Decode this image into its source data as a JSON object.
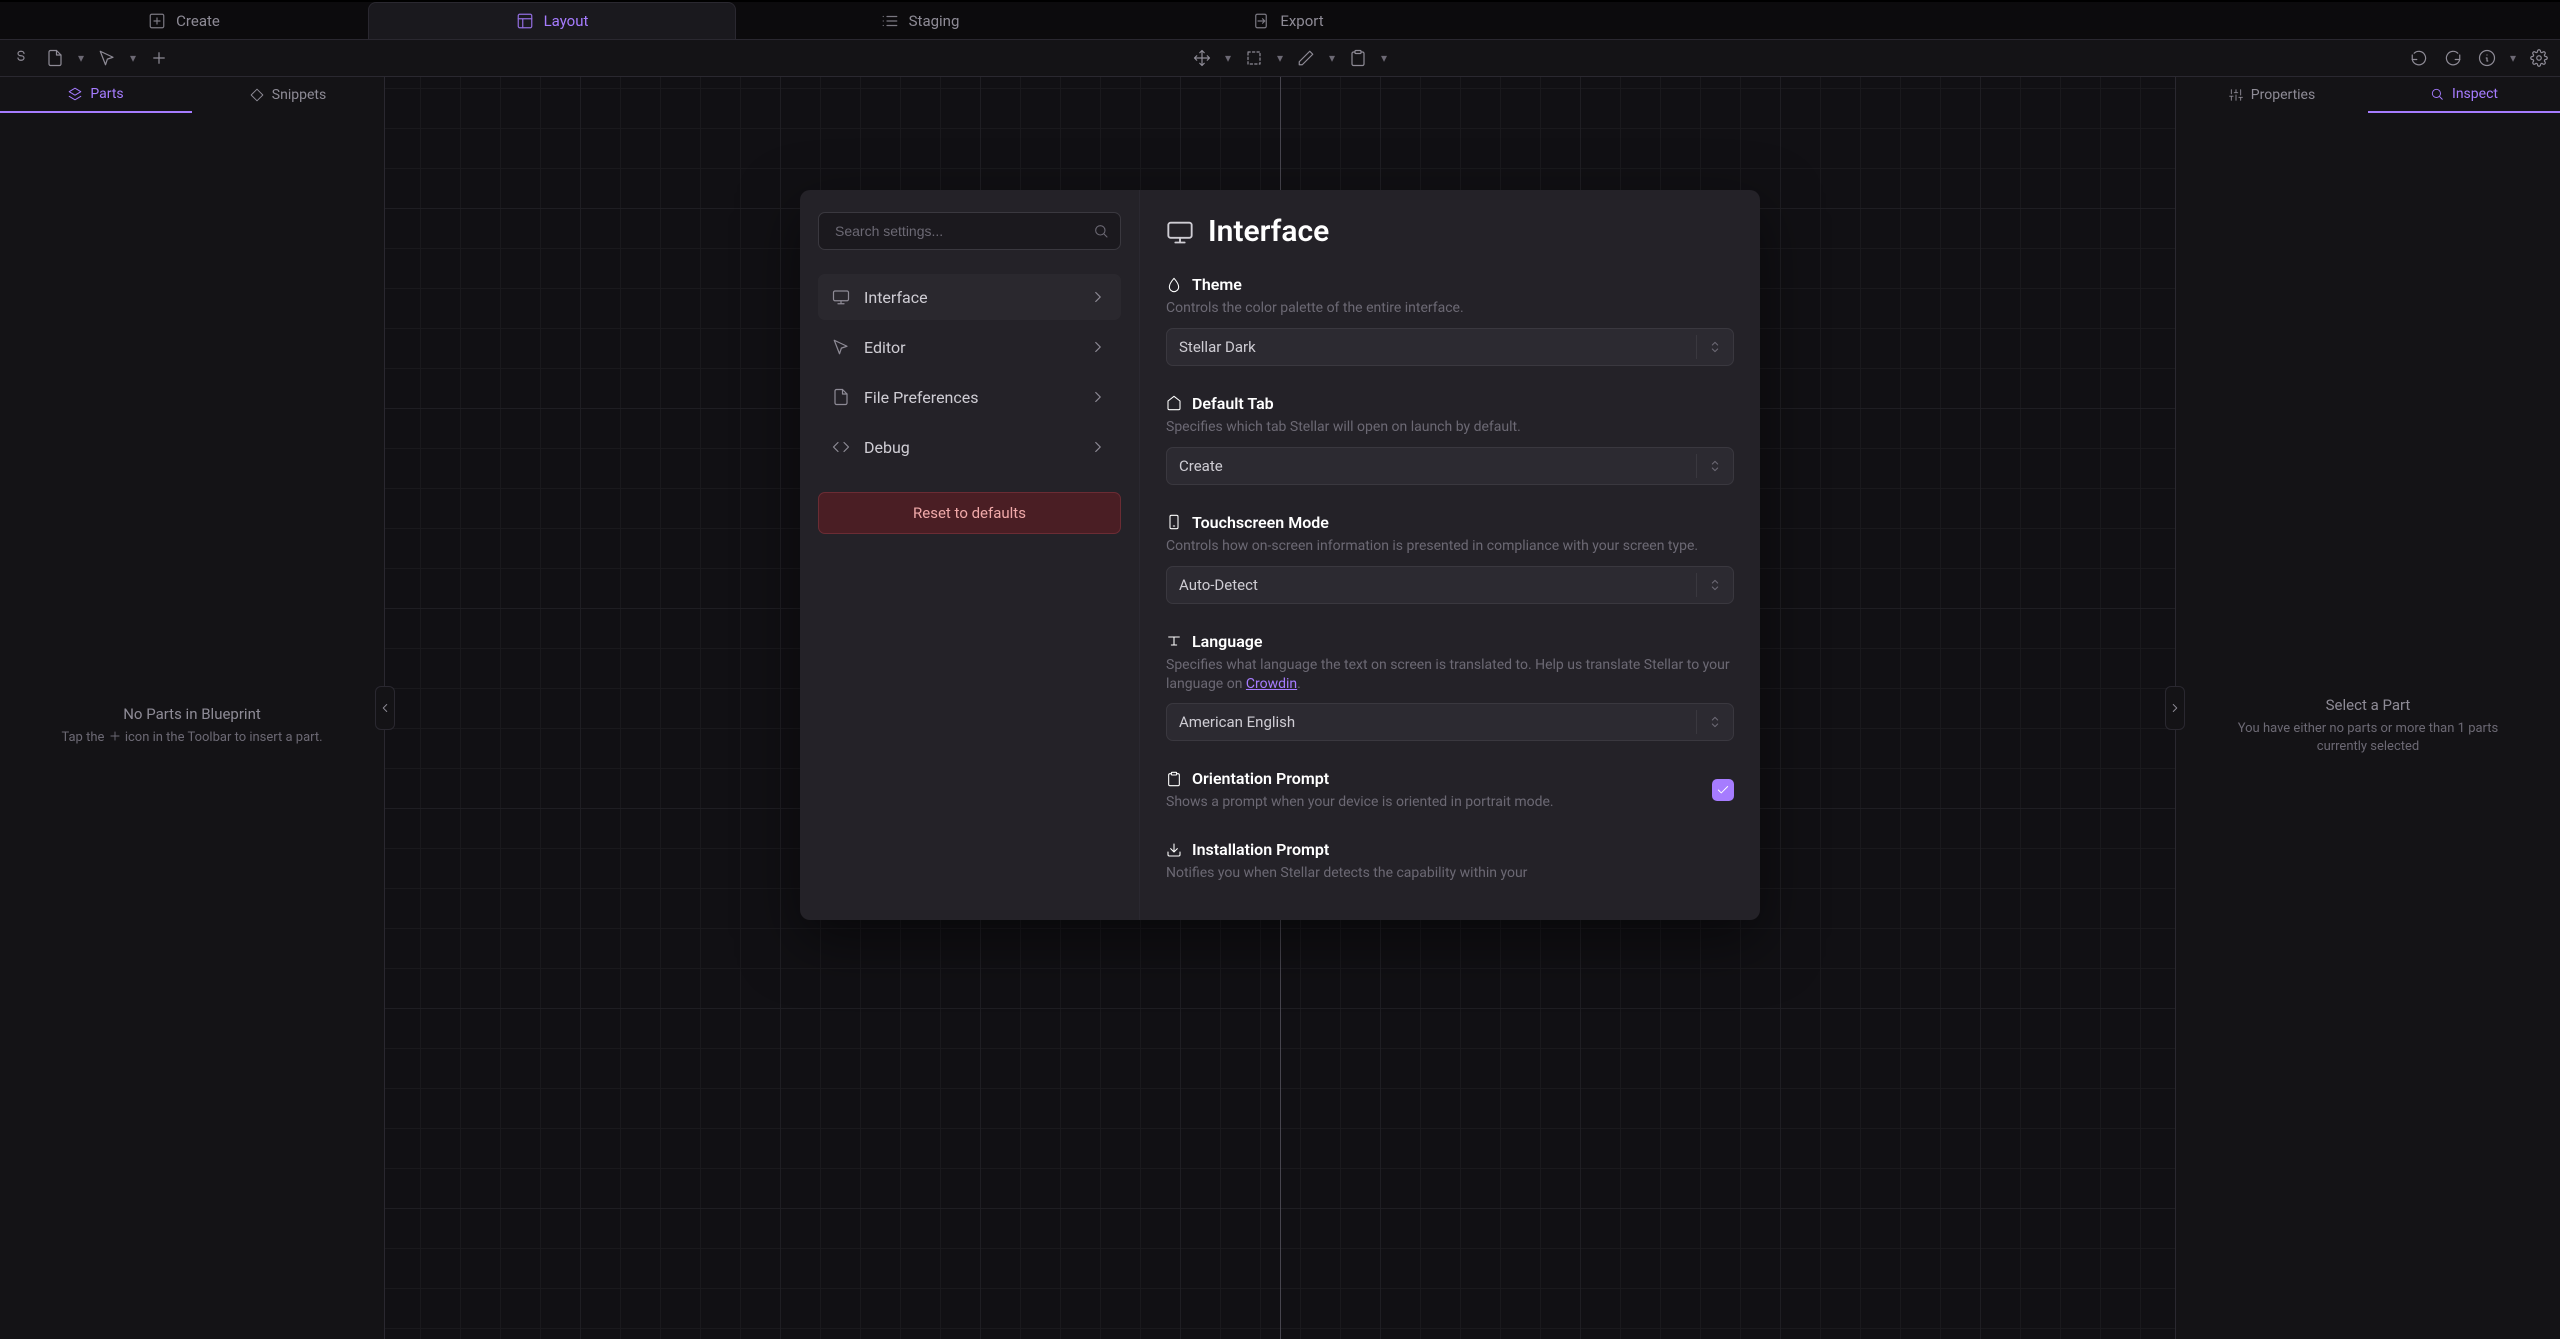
{
  "main_tabs": {
    "create": "Create",
    "layout": "Layout",
    "staging": "Staging",
    "export": "Export"
  },
  "left_panel": {
    "tabs": {
      "parts": "Parts",
      "snippets": "Snippets"
    },
    "empty_title": "No Parts in Blueprint",
    "empty_desc_pre": "Tap the ",
    "empty_desc_post": " icon in the Toolbar to insert a part."
  },
  "right_panel": {
    "tabs": {
      "properties": "Properties",
      "inspect": "Inspect"
    },
    "empty_title": "Select a Part",
    "empty_desc": "You have either no parts or more than 1 parts currently selected"
  },
  "settings": {
    "search_placeholder": "Search settings...",
    "categories": {
      "interface": "Interface",
      "editor": "Editor",
      "file_prefs": "File Preferences",
      "debug": "Debug"
    },
    "reset": "Reset to defaults",
    "page_title": "Interface",
    "items": {
      "theme": {
        "label": "Theme",
        "desc": "Controls the color palette of the entire interface.",
        "value": "Stellar Dark"
      },
      "default_tab": {
        "label": "Default Tab",
        "desc": "Specifies which tab Stellar will open on launch by default.",
        "value": "Create"
      },
      "touch": {
        "label": "Touchscreen Mode",
        "desc": "Controls how on-screen information is presented in compliance with your screen type.",
        "value": "Auto-Detect"
      },
      "language": {
        "label": "Language",
        "desc_pre": "Specifies what language the text on screen is translated to. Help us translate Stellar to your language on ",
        "desc_link": "Crowdin",
        "desc_post": ".",
        "value": "American English"
      },
      "orientation": {
        "label": "Orientation Prompt",
        "desc": "Shows a prompt when your device is oriented in portrait mode.",
        "checked": true
      },
      "install": {
        "label": "Installation Prompt",
        "desc": "Notifies you when Stellar detects the capability within your"
      }
    }
  }
}
